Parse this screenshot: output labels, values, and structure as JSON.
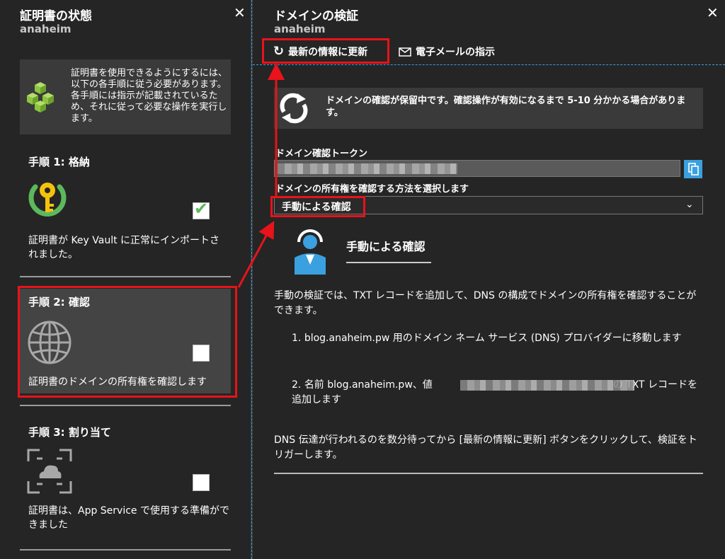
{
  "left_blade": {
    "title": "証明書の状態",
    "subtitle": "anaheim",
    "close_label": "✕",
    "intro": "証明書を使用できるようにするには、以下の各手順に従う必要があります。各手順には指示が記載されているため、それに従って必要な操作を実行します。",
    "steps": [
      {
        "title": "手順 1: 格納",
        "desc": "証明書が Key Vault に正常にインポートされました。",
        "checked": true
      },
      {
        "title": "手順 2: 確認",
        "desc": "証明書のドメインの所有権を確認します",
        "checked": false
      },
      {
        "title": "手順 3: 割り当て",
        "desc": "証明書は、App Service で使用する準備ができました",
        "checked": false
      }
    ],
    "checkmark": "✔"
  },
  "right_blade": {
    "title": "ドメインの検証",
    "subtitle": "anaheim",
    "close_label": "✕",
    "toolbar": {
      "refresh_label": "最新の情報に更新",
      "email_label": "電子メールの指示"
    },
    "pending_message": "ドメインの確認が保留中です。確認操作が有効になるまで 5-10 分かかる場合があります。",
    "token_label": "ドメイン確認トークン",
    "method_label": "ドメインの所有権を確認する方法を選択します",
    "method_value": "手動による確認",
    "manual_heading": "手動による確認",
    "manual_intro": "手動の検証では、TXT レコードを追加して、DNS の構成でドメインの所有権を確認することができます。",
    "instructions": [
      {
        "num": "1.",
        "text": "blog.anaheim.pw 用のドメイン ネーム サービス (DNS) プロバイダーに移動します"
      },
      {
        "num": "2.",
        "pre": "名前 blog.anaheim.pw、値",
        "post": "の TXT レコードを追加します"
      }
    ],
    "footer_text": "DNS 伝達が行われるのを数分待ってから [最新の情報に更新] ボタンをクリックして、検証をトリガーします。"
  },
  "colors": {
    "highlight_red": "#e8131b",
    "accent_blue": "#3aa0e0",
    "check_green": "#5cb85c",
    "key_yellow": "#f4c20d",
    "cube_green": "#8cc63f"
  }
}
